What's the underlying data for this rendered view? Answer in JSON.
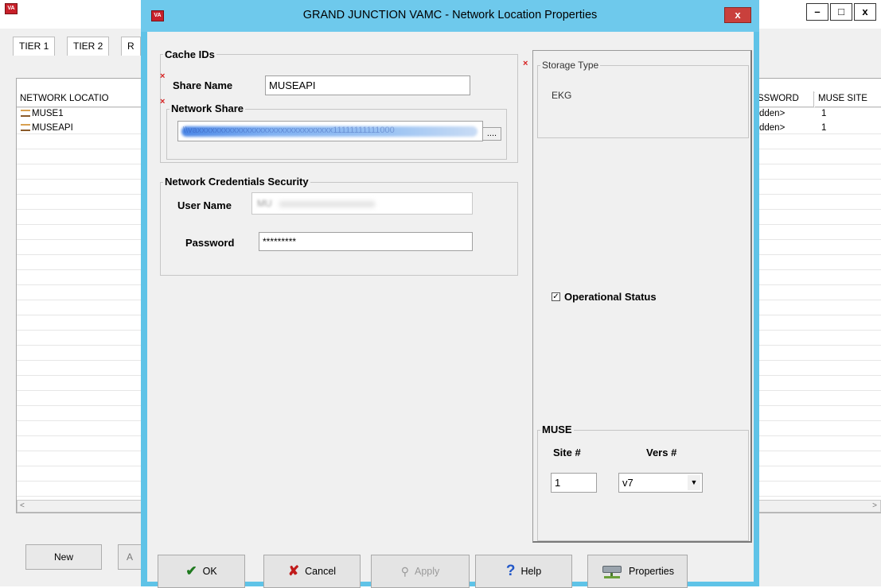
{
  "main_window": {
    "tabs": [
      "TIER 1",
      "TIER 2",
      "R"
    ],
    "left_column_header": "NETWORK LOCATIO",
    "rows": [
      "MUSE1",
      "MUSEAPI"
    ],
    "right_columns": [
      "SSWORD",
      "MUSE SITE"
    ],
    "right_rows": [
      {
        "password": "dden>",
        "site": "1"
      },
      {
        "password": "dden>",
        "site": "1"
      }
    ],
    "scroll_left": "<",
    "scroll_right": ">",
    "new_button": "New",
    "second_button": "A"
  },
  "window_controls": {
    "minimize": "–",
    "maximize": "□",
    "close": "x"
  },
  "dialog": {
    "title": "GRAND JUNCTION VAMC  -  Network Location Properties",
    "close_label": "x",
    "app_icon_text": "VA",
    "required_marker": "×",
    "cache_ids": {
      "label": "Cache IDs",
      "share_name_label": "Share Name",
      "share_name_value": "MUSEAPI",
      "network_share_label": "Network Share",
      "network_share_value": "\\\\vaxxxxxxxxxxxxxxxxxxxxxxxxxxxxxxx11111111111000",
      "browse_button": "...."
    },
    "credentials": {
      "label": "Network Credentials Security",
      "user_name_label": "User Name",
      "user_name_value": "MU",
      "password_label": "Password",
      "password_value": "*********"
    },
    "storage_type": {
      "label": "Storage Type",
      "value": "EKG"
    },
    "operational_status": {
      "label": "Operational Status",
      "checked": true
    },
    "muse": {
      "label": "MUSE",
      "site_label": "Site #",
      "vers_label": "Vers #",
      "site_value": "1",
      "vers_value": "v7"
    },
    "buttons": {
      "ok": "OK",
      "cancel": "Cancel",
      "apply": "Apply",
      "help": "Help",
      "properties": "Properties"
    }
  }
}
